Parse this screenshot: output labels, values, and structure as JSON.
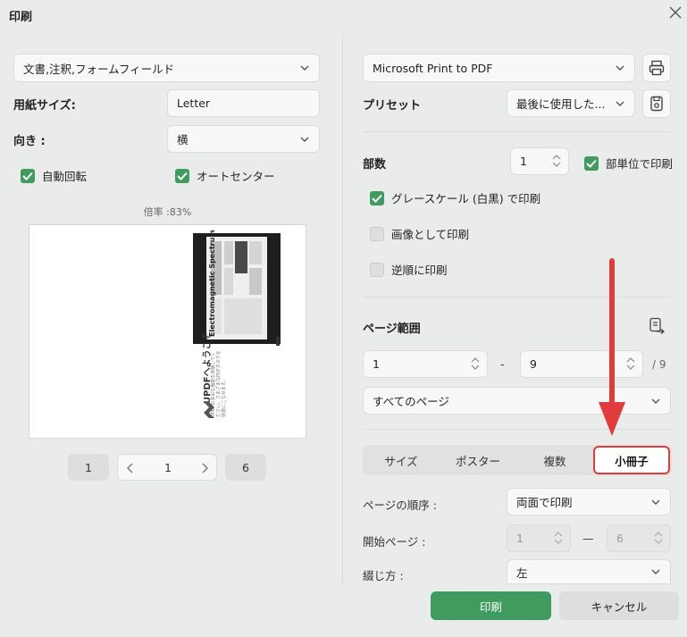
{
  "window": {
    "title": "印刷"
  },
  "left": {
    "content_select": {
      "value": "文書,注釈,フォームフィールド"
    },
    "paper_size": {
      "label": "用紙サイズ:",
      "value": "Letter"
    },
    "orientation": {
      "label": "向き :",
      "value": "横"
    },
    "auto_rotate": {
      "label": "自動回転",
      "checked": true
    },
    "auto_center": {
      "label": "オートセンター",
      "checked": true
    },
    "scale_text": "倍率 :83%",
    "preview": {
      "page_heading": "Electromagnetic Spectrum",
      "welcome_text": "UPDFへようこそ",
      "welcome_subtext": "UPDFの多彩な機能を体験してください。さまざまなPDFタスクを快適にこなせます。"
    },
    "pager": {
      "first": "1",
      "current": "1",
      "last": "6"
    }
  },
  "right": {
    "printer_select": {
      "value": "Microsoft Print to PDF"
    },
    "preset": {
      "label": "プリセット",
      "value": "最後に使用した..."
    },
    "copies": {
      "label": "部数",
      "value": "1"
    },
    "collate": {
      "label": "部単位で印刷",
      "checked": true
    },
    "grayscale": {
      "label": "グレースケール (白黒) で印刷",
      "checked": true
    },
    "print_as_image": {
      "label": "画像として印刷",
      "checked": false
    },
    "reverse_order": {
      "label": "逆順に印刷",
      "checked": false
    },
    "page_range": {
      "label": "ページ範囲",
      "from": "1",
      "separator": "-",
      "to": "9",
      "total": "/ 9",
      "subset": "すべてのページ"
    },
    "tabs": [
      {
        "label": "サイズ",
        "active": false
      },
      {
        "label": "ポスター",
        "active": false
      },
      {
        "label": "複数",
        "active": false
      },
      {
        "label": "小冊子",
        "active": true
      }
    ],
    "booklet": {
      "page_order": {
        "label": "ページの順序 :",
        "value": "両面で印刷"
      },
      "start_page": {
        "label": "開始ページ :",
        "from": "1",
        "separator": "—",
        "to": "6"
      },
      "binding": {
        "label": "綴じ方 :",
        "value": "左"
      }
    }
  },
  "footer": {
    "print_label": "印刷",
    "cancel_label": "キャンセル"
  },
  "colors": {
    "accent": "#3f9c5e",
    "highlight": "#e23b3b",
    "background": "#e9ecea"
  }
}
